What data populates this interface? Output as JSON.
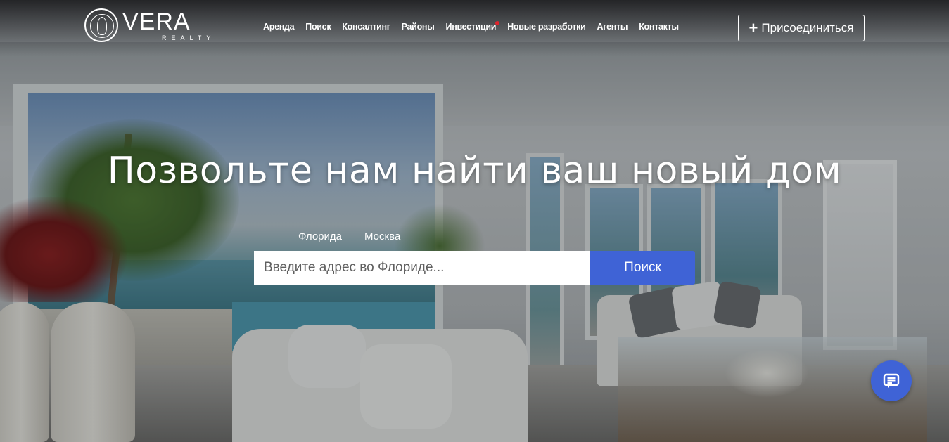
{
  "header": {
    "logo": {
      "name": "VERA",
      "tagline": "REALTY"
    },
    "nav": [
      {
        "label": "Аренда"
      },
      {
        "label": "Поиск"
      },
      {
        "label": "Консалтинг"
      },
      {
        "label": "Районы"
      },
      {
        "label": "Инвестиции",
        "badge_color": "#e0242c"
      },
      {
        "label": "Новые разработки"
      },
      {
        "label": "Агенты"
      },
      {
        "label": "Контакты"
      }
    ],
    "join_button": {
      "icon": "plus-icon",
      "label": "Присоединиться"
    }
  },
  "hero": {
    "headline": "Позвольте нам найти ваш новый дом",
    "tabs": [
      {
        "label": "Флорида",
        "active": true
      },
      {
        "label": "Москва",
        "active": false
      }
    ],
    "search": {
      "placeholder": "Введите адрес во Флориде...",
      "value": "",
      "button_label": "Поиск"
    }
  },
  "chat_widget": {
    "icon": "chat-icon"
  },
  "colors": {
    "accent": "#3f63d6",
    "notification_dot": "#e0242c",
    "text": "#ffffff"
  }
}
